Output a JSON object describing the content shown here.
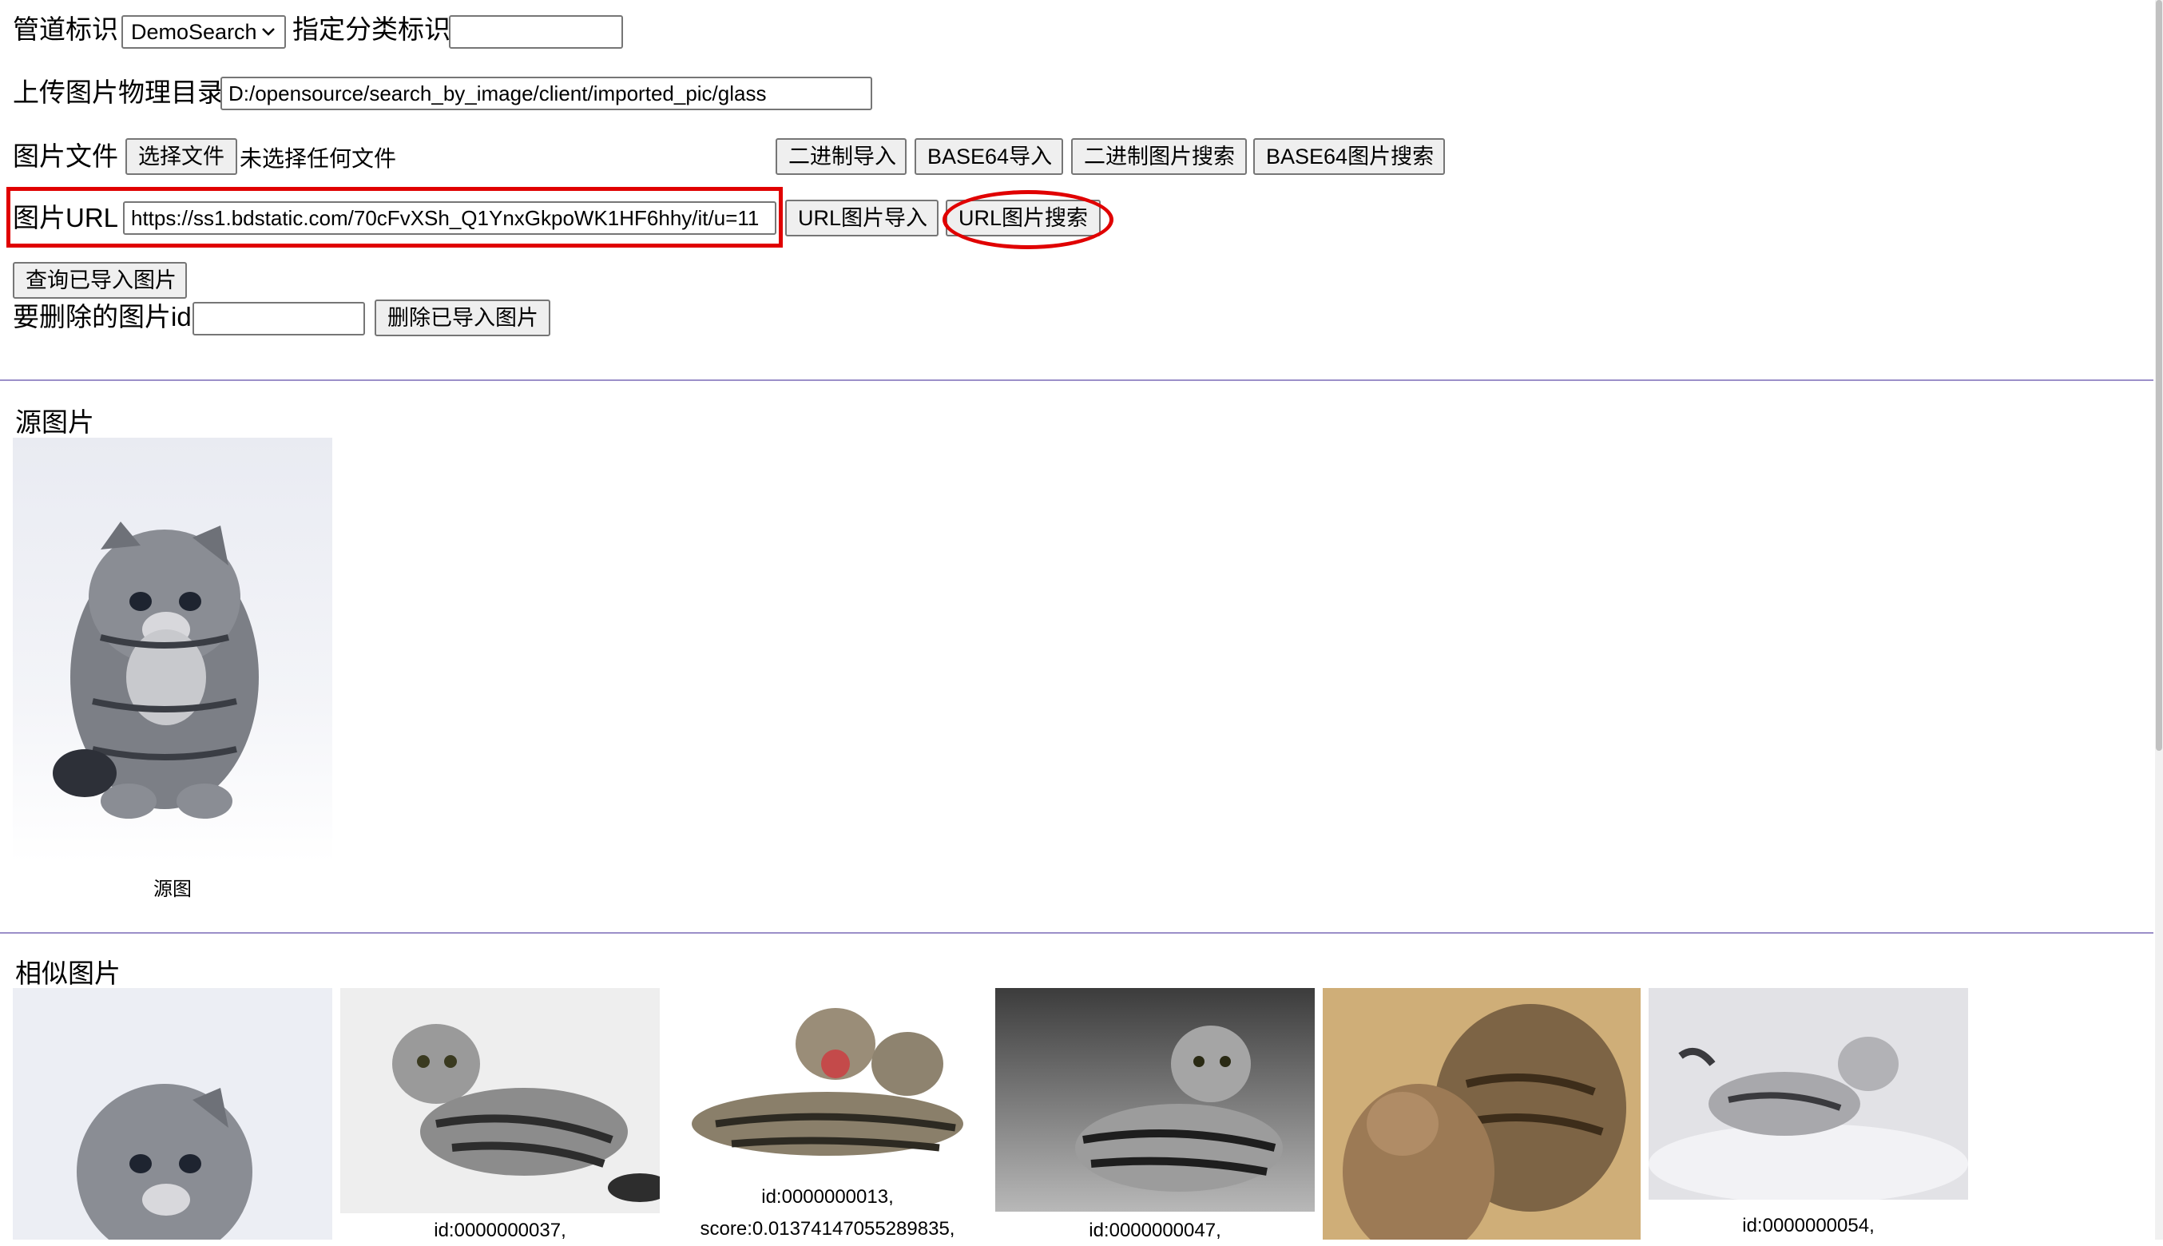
{
  "form": {
    "pipeline_label": "管道标识",
    "pipeline_value": "DemoSearch",
    "category_label": "指定分类标识",
    "category_value": "",
    "upload_dir_label": "上传图片物理目录",
    "upload_dir_value": "D:/opensource/search_by_image/client/imported_pic/glass",
    "file_label": "图片文件",
    "choose_file_label": "选择文件",
    "no_file_text": "未选择任何文件",
    "binary_import": "二进制导入",
    "base64_import": "BASE64导入",
    "binary_search": "二进制图片搜索",
    "base64_search": "BASE64图片搜索",
    "url_label": "图片URL",
    "url_value": "https://ss1.bdstatic.com/70cFvXSh_Q1YnxGkpoWK1HF6hhy/it/u=11",
    "url_import": "URL图片导入",
    "url_search": "URL图片搜索",
    "query_imported": "查询已导入图片",
    "delete_id_label": "要删除的图片id",
    "delete_id_value": "",
    "delete_imported": "删除已导入图片"
  },
  "source": {
    "heading": "源图片",
    "caption": "源图"
  },
  "similar": {
    "heading": "相似图片",
    "items": [
      {
        "caption_line1": "",
        "caption_line2": ""
      },
      {
        "caption_line1": "id:0000000037,",
        "caption_line2": ""
      },
      {
        "caption_line1": "id:0000000013,",
        "caption_line2": "score:0.01374147055289835,"
      },
      {
        "caption_line1": "id:0000000047,",
        "caption_line2": ""
      },
      {
        "caption_line1": "",
        "caption_line2": ""
      },
      {
        "caption_line1": "id:0000000054,",
        "caption_line2": ""
      }
    ]
  },
  "colors": {
    "highlight": "#e00000",
    "divider": "#9b8fc9"
  }
}
